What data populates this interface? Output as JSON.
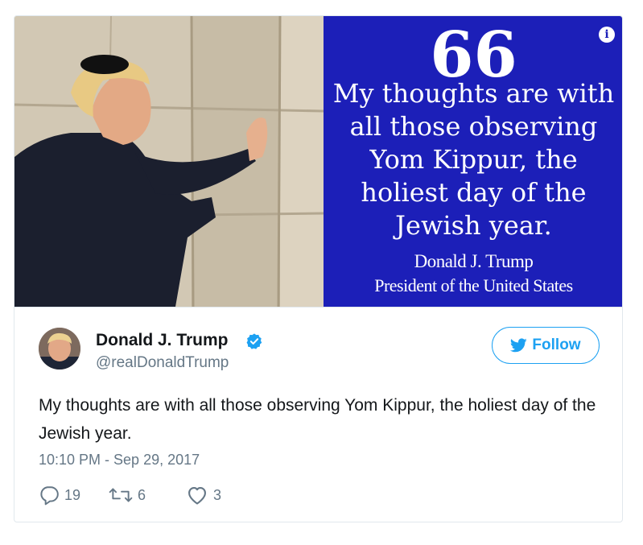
{
  "media": {
    "quote_mark": "66",
    "quote_text": "My thoughts are with all those observing Yom Kippur, the holiest day of the Jewish year.",
    "signature_name": "Donald J. Trump",
    "signature_title": "President of the United States",
    "panel_color": "#1c1fb8",
    "info_icon": "i"
  },
  "tweet": {
    "author_name": "Donald J. Trump",
    "handle": "@realDonaldTrump",
    "verified_icon": "verified-badge-icon",
    "follow_label": "Follow",
    "text": "My thoughts are with all those observing Yom Kippur, the holiest day of the Jewish year.",
    "timestamp": "10:10 PM - Sep 29, 2017",
    "replies": "19",
    "retweets": "6",
    "likes": "3",
    "accent_color": "#1da1f2"
  }
}
